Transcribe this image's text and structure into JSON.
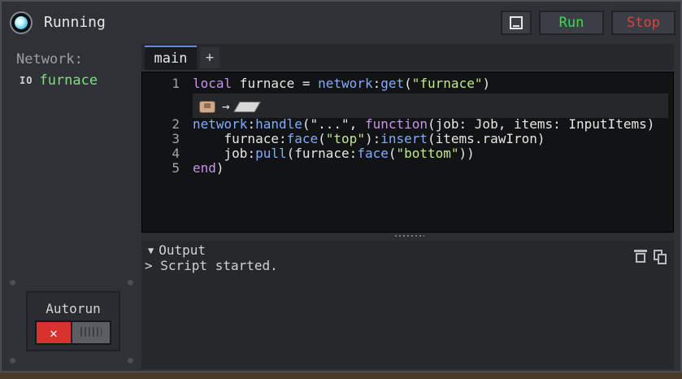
{
  "window": {
    "title": "Running"
  },
  "toolbar": {
    "run_label": "Run",
    "stop_label": "Stop",
    "book_icon": "book-icon"
  },
  "sidebar": {
    "network_label": "Network:",
    "items": [
      {
        "icon": "IO",
        "label": "furnace"
      }
    ],
    "autorun": {
      "label": "Autorun",
      "state": "off",
      "off_glyph": "✕"
    }
  },
  "tabs": {
    "items": [
      {
        "label": "main"
      }
    ],
    "add_label": "+"
  },
  "editor": {
    "lines": [
      {
        "no": "1",
        "tokens": [
          {
            "t": "local",
            "c": "k"
          },
          {
            "t": " furnace = ",
            "c": "p"
          },
          {
            "t": "network",
            "c": "f"
          },
          {
            "t": ":",
            "c": "p"
          },
          {
            "t": "get",
            "c": "f"
          },
          {
            "t": "(",
            "c": "p"
          },
          {
            "t": "\"furnace\"",
            "c": "s"
          },
          {
            "t": ")",
            "c": "p"
          }
        ]
      },
      {
        "no": "2",
        "tokens": [
          {
            "t": "network",
            "c": "f"
          },
          {
            "t": ":",
            "c": "p"
          },
          {
            "t": "handle",
            "c": "f"
          },
          {
            "t": "(\"...\", ",
            "c": "p"
          },
          {
            "t": "function",
            "c": "k"
          },
          {
            "t": "(job: Job, items: InputItems)",
            "c": "p"
          }
        ]
      },
      {
        "no": "3",
        "tokens": [
          {
            "t": "    furnace",
            "c": "p"
          },
          {
            "t": ":",
            "c": "p"
          },
          {
            "t": "face",
            "c": "f"
          },
          {
            "t": "(",
            "c": "p"
          },
          {
            "t": "\"top\"",
            "c": "s"
          },
          {
            "t": "):",
            "c": "p"
          },
          {
            "t": "insert",
            "c": "f"
          },
          {
            "t": "(items.rawIron)",
            "c": "p"
          }
        ]
      },
      {
        "no": "4",
        "tokens": [
          {
            "t": "    job",
            "c": "p"
          },
          {
            "t": ":",
            "c": "p"
          },
          {
            "t": "pull",
            "c": "f"
          },
          {
            "t": "(furnace",
            "c": "p"
          },
          {
            "t": ":",
            "c": "p"
          },
          {
            "t": "face",
            "c": "f"
          },
          {
            "t": "(",
            "c": "p"
          },
          {
            "t": "\"bottom\"",
            "c": "s"
          },
          {
            "t": "))",
            "c": "p"
          }
        ]
      },
      {
        "no": "5",
        "tokens": [
          {
            "t": "end",
            "c": "k"
          },
          {
            "t": ")",
            "c": "p"
          }
        ]
      }
    ],
    "item_hint": {
      "from_icon": "raw-iron-icon",
      "arrow": "→",
      "to_icon": "iron-ingot-icon"
    }
  },
  "output": {
    "header": "Output",
    "lines": [
      "> Script started."
    ],
    "trash_icon": "trash-icon",
    "copy_icon": "copy-icon"
  },
  "colors": {
    "run": "#3fd94b",
    "stop": "#e0413d",
    "keyword": "#c792ea",
    "function": "#82aaff",
    "string": "#c3e88d",
    "network_item": "#7ee07e"
  }
}
